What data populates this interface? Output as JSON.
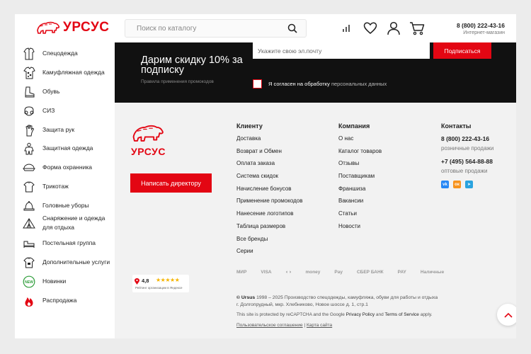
{
  "header": {
    "logo_text": "УРСУС",
    "search_placeholder": "Поиск по каталогу",
    "phone": "8 (800) 222-43-16",
    "phone_sub": "Интернет-магазин"
  },
  "sidebar": {
    "items": [
      {
        "label": "Спецодежда",
        "icon": "jacket-icon"
      },
      {
        "label": "Камуфляжная одежда",
        "icon": "camo-shirt-icon"
      },
      {
        "label": "Обувь",
        "icon": "boot-icon"
      },
      {
        "label": "СИЗ",
        "icon": "respirator-icon"
      },
      {
        "label": "Защита рук",
        "icon": "glove-icon"
      },
      {
        "label": "Защитная одежда",
        "icon": "protective-suit-icon"
      },
      {
        "label": "Форма охранника",
        "icon": "guard-cap-icon"
      },
      {
        "label": "Трикотаж",
        "icon": "tshirt-icon"
      },
      {
        "label": "Головные уборы",
        "icon": "hat-icon"
      },
      {
        "label": "Снаряжение и одежда для отдыха",
        "icon": "tent-icon"
      },
      {
        "label": "Постельная группа",
        "icon": "bedding-icon"
      },
      {
        "label": "Дополнительные услуги",
        "icon": "print-shirt-icon"
      },
      {
        "label": "Новинки",
        "icon": "new-badge-icon",
        "badge": "NEW"
      },
      {
        "label": "Распродажа",
        "icon": "fire-icon"
      }
    ]
  },
  "promo": {
    "title": "Дарим скидку 10% за подписку",
    "rules_link": "Правила применения промокодов",
    "email_placeholder": "Укажите свою эл.почту",
    "subscribe_label": "Подписаться",
    "agree_text": "Я согласен на обработку",
    "agree_link": "персональных данных"
  },
  "footer": {
    "logo_text": "УРСУС",
    "director_button": "Написать директору",
    "client": {
      "title": "Клиенту",
      "links": [
        "Доставка",
        "Возврат и Обмен",
        "Оплата заказа",
        "Система скидок",
        "Начисление бонусов",
        "Применение промокодов",
        "Нанесение логотипов",
        "Таблица размеров",
        "Все бренды",
        "Серии"
      ]
    },
    "company": {
      "title": "Компания",
      "links": [
        "О нас",
        "Каталог товаров",
        "Отзывы",
        "Поставщикам",
        "Франшиза",
        "Вакансии",
        "Статьи",
        "Новости"
      ]
    },
    "contacts": {
      "title": "Контакты",
      "phone1": "8 (800) 222-43-16",
      "phone1_sub": "розничные продажи",
      "phone2": "+7 (495) 564-88-88",
      "phone2_sub": "оптовые продажи",
      "socials": [
        {
          "name": "vk-icon",
          "glyph": "vk",
          "color": "#2787f5"
        },
        {
          "name": "ok-icon",
          "glyph": "ок",
          "color": "#f7931e"
        },
        {
          "name": "telegram-icon",
          "glyph": "➤",
          "color": "#2aa3df"
        }
      ]
    },
    "rating": {
      "value": "4,8",
      "stars": "★★★★★",
      "caption": "Рейтинг организации в Яндексе"
    },
    "payments": [
      "МИР",
      "VISA",
      "◐◑",
      "money",
      "Pay",
      "СБЕР БАНК",
      "PAY",
      "Наличные"
    ],
    "copyright_brand": "© Ursus",
    "copyright_text": "1998 – 2025 Производство спецодежды, камуфляжа, обуви для работы и отдыха",
    "address": "г. Долгопрудный, мкр. Хлебниково, Новое шоссе д. 1, стр.1",
    "recaptcha_pre": "This site is protected by reCAPTCHA and the Google",
    "privacy": "Privacy Policy",
    "and": "and",
    "terms": "Terms of Service",
    "apply": "apply.",
    "agreement": "Пользовательское соглашение",
    "separator": "|",
    "sitemap": "Карта сайта"
  },
  "colors": {
    "accent": "#e30613",
    "dark": "#111111",
    "footer_bg": "#f2f2f2"
  }
}
